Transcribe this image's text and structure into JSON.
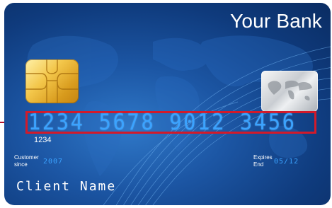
{
  "card": {
    "bank_name": "Your Bank",
    "card_number": "1234 5678 9012 3456",
    "card_number_small": "1234",
    "customer_since_label_line1": "Customer",
    "customer_since_label_line2": "since",
    "customer_since_year": "2007",
    "expires_label_line1": "Expires",
    "expires_label_line2": "End",
    "expires_value": "05/12",
    "client_name": "Client Name"
  },
  "colors": {
    "card_background": "#1c56a4",
    "number_color": "#3ba3ff",
    "highlight_box": "#d21a2a",
    "chip_gold": "#f3c64a"
  },
  "icons": [
    "chip-icon",
    "hologram-icon",
    "world-map-icon"
  ]
}
